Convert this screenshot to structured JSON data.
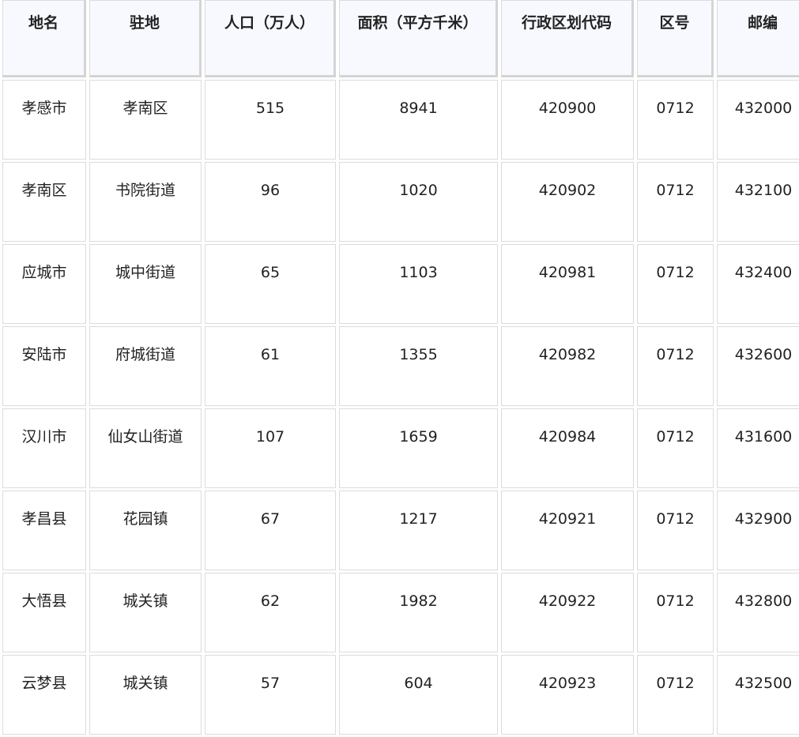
{
  "table": {
    "headers": [
      "地名",
      "驻地",
      "人口（万人）",
      "面积（平方千米）",
      "行政区划代码",
      "区号",
      "邮编"
    ],
    "rows": [
      [
        "孝感市",
        "孝南区",
        "515",
        "8941",
        "420900",
        "0712",
        "432000"
      ],
      [
        "孝南区",
        "书院街道",
        "96",
        "1020",
        "420902",
        "0712",
        "432100"
      ],
      [
        "应城市",
        "城中街道",
        "65",
        "1103",
        "420981",
        "0712",
        "432400"
      ],
      [
        "安陆市",
        "府城街道",
        "61",
        "1355",
        "420982",
        "0712",
        "432600"
      ],
      [
        "汉川市",
        "仙女山街道",
        "107",
        "1659",
        "420984",
        "0712",
        "431600"
      ],
      [
        "孝昌县",
        "花园镇",
        "67",
        "1217",
        "420921",
        "0712",
        "432900"
      ],
      [
        "大悟县",
        "城关镇",
        "62",
        "1982",
        "420922",
        "0712",
        "432800"
      ],
      [
        "云梦县",
        "城关镇",
        "57",
        "604",
        "420923",
        "0712",
        "432500"
      ]
    ]
  }
}
